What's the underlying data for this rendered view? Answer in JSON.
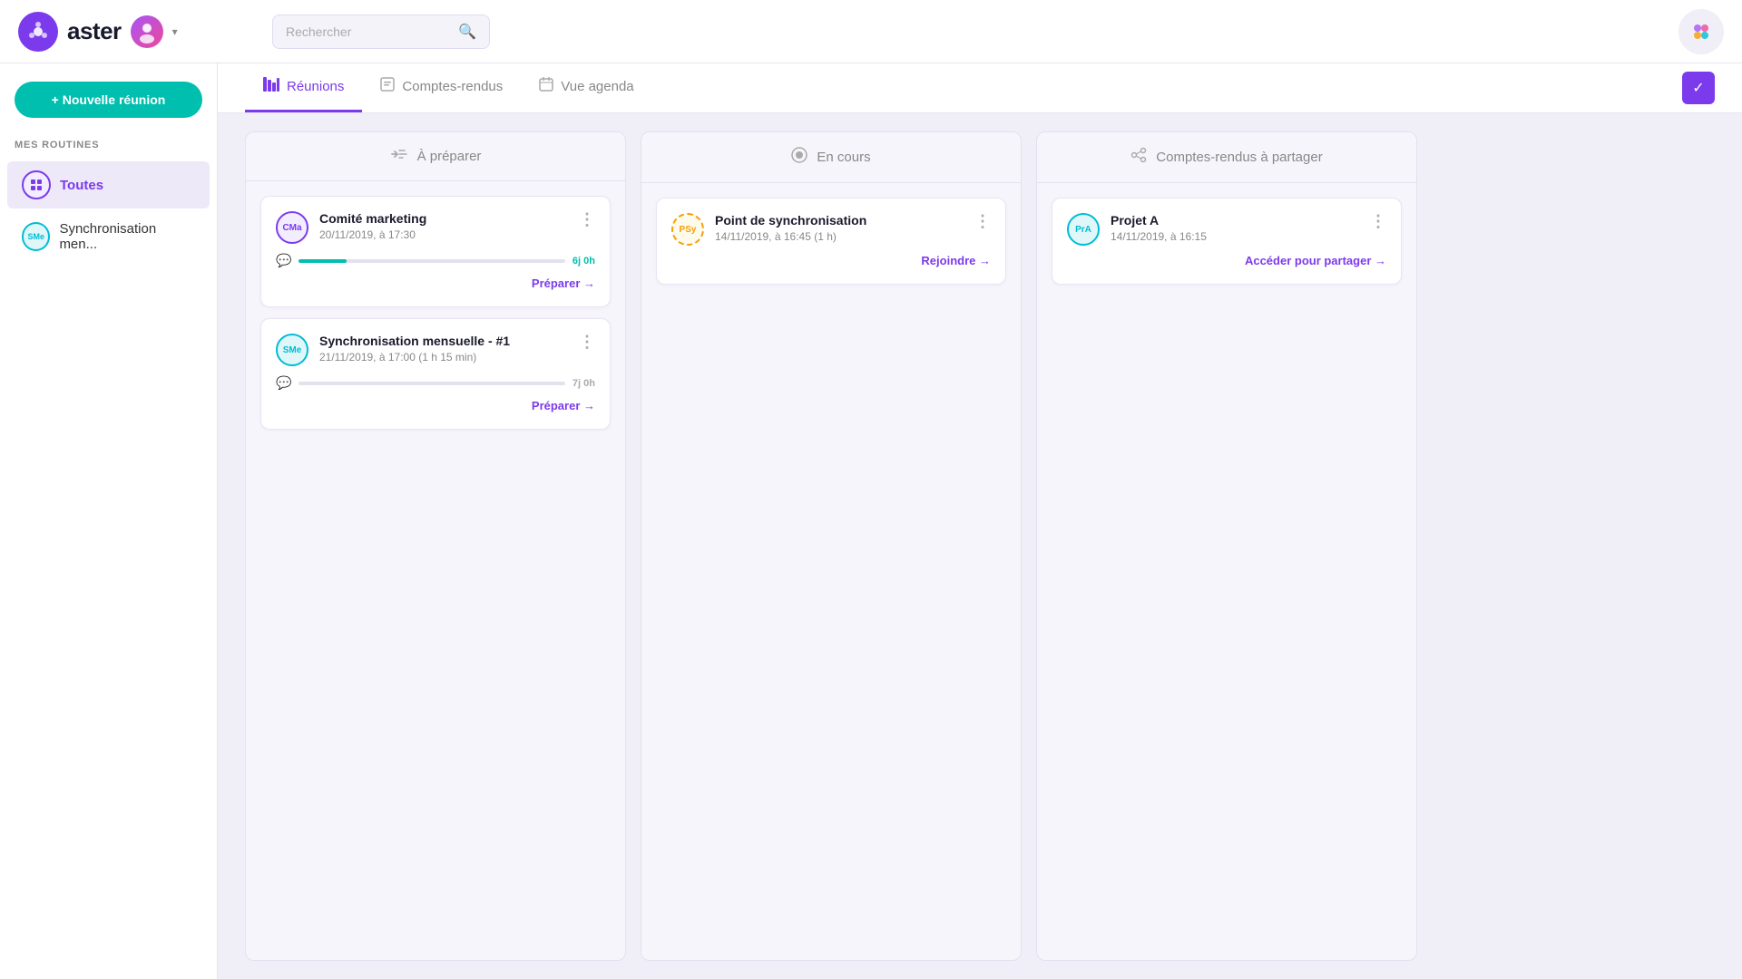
{
  "header": {
    "logo_text": "aster",
    "search_placeholder": "Rechercher",
    "app_icon_label": "apps"
  },
  "sidebar": {
    "new_meeting_label": "+ Nouvelle réunion",
    "section_title": "MES ROUTINES",
    "items": [
      {
        "id": "toutes",
        "icon_text": "⬛",
        "icon_type": "purple",
        "label": "Toutes",
        "active": true
      },
      {
        "id": "synchronisation",
        "icon_text": "SMe",
        "icon_type": "teal",
        "label": "Synchronisation men...",
        "active": false
      }
    ]
  },
  "tabs": [
    {
      "id": "reunions",
      "label": "Réunions",
      "icon": "reunions",
      "active": true
    },
    {
      "id": "comptes-rendus",
      "label": "Comptes-rendus",
      "icon": "comptes",
      "active": false
    },
    {
      "id": "vue-agenda",
      "label": "Vue agenda",
      "icon": "agenda",
      "active": false
    }
  ],
  "columns": [
    {
      "id": "a-preparer",
      "title": "À préparer",
      "icon": "arrow",
      "cards": [
        {
          "id": "comite-marketing",
          "avatar_text": "CMa",
          "avatar_class": "cma",
          "title": "Comité marketing",
          "date": "20/11/2019, à 17:30",
          "progress_fill_pct": 18,
          "progress_label": "6j 0h",
          "progress_label_class": "green",
          "action_label": "Préparer →"
        },
        {
          "id": "synchronisation-mensuelle",
          "avatar_text": "SMe",
          "avatar_class": "sme",
          "title": "Synchronisation mensuelle - #1",
          "date": "21/11/2019, à 17:00 (1 h 15 min)",
          "progress_fill_pct": 2,
          "progress_label": "7j 0h",
          "progress_label_class": "gray",
          "action_label": "Préparer →"
        }
      ]
    },
    {
      "id": "en-cours",
      "title": "En cours",
      "icon": "record",
      "cards": [
        {
          "id": "point-synchronisation",
          "avatar_text": "PSy",
          "avatar_class": "psy",
          "title": "Point de synchronisation",
          "date": "14/11/2019, à 16:45 (1 h)",
          "progress_fill_pct": 0,
          "progress_label": "",
          "progress_label_class": "",
          "action_label": "Rejoindre →"
        }
      ]
    },
    {
      "id": "comptes-rendus-a-partager",
      "title": "Comptes-rendus à partager",
      "icon": "share",
      "cards": [
        {
          "id": "projet-a",
          "avatar_text": "PrA",
          "avatar_class": "pra",
          "title": "Projet A",
          "date": "14/11/2019, à 16:15",
          "progress_fill_pct": 0,
          "progress_label": "",
          "progress_label_class": "",
          "action_label": "Accéder pour partager →"
        }
      ]
    }
  ]
}
